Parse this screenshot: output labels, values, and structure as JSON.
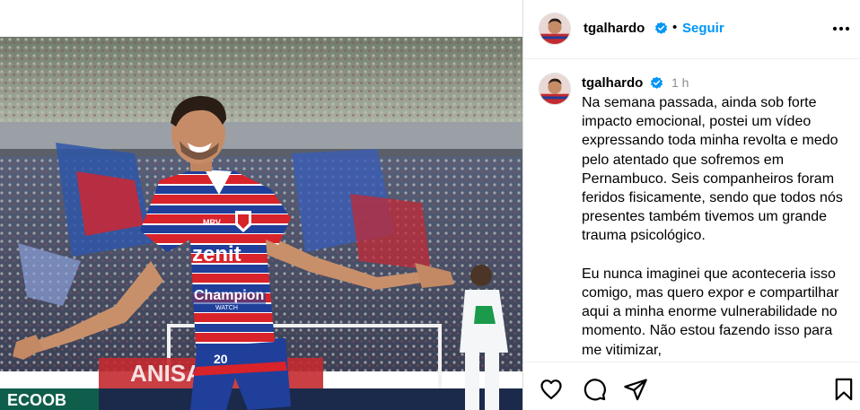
{
  "post": {
    "username": "tgalhardo",
    "follow_label": "Seguir",
    "separator": "•",
    "time_ago": "1 h",
    "caption_paragraphs": [
      "Na semana passada, ainda sob forte impacto emocional, postei um vídeo expressando toda minha revolta e medo pelo atentado que sofremos em Pernambuco. Seis companheiros foram feridos fisicamente, sendo que todos nós presentes também tivemos um grande trauma psicológico.",
      "Eu nunca imaginei que aconteceria isso comigo, mas quero expor e compartilhar aqui a minha enorme vulnerabilidade no momento. Não estou fazendo isso para me vitimizar,"
    ]
  },
  "photo": {
    "sponsor_front": "zenit",
    "sponsor_chest": "Champion",
    "sponsor_chest_sub": "WATCH",
    "sponsor_small": "MRV",
    "shorts_number": "20",
    "ad_board_left": "ECOOB",
    "ad_board_mid": "ANISA"
  },
  "colors": {
    "accent_blue": "#0095f6",
    "verified_blue": "#0095f6",
    "kit_red": "#d8232a",
    "kit_blue": "#1f3f9b"
  },
  "icons": {
    "more": "more-horizontal-icon",
    "like": "heart-icon",
    "comment": "comment-icon",
    "share": "share-icon",
    "save": "bookmark-icon",
    "verified": "verified-badge-icon"
  }
}
